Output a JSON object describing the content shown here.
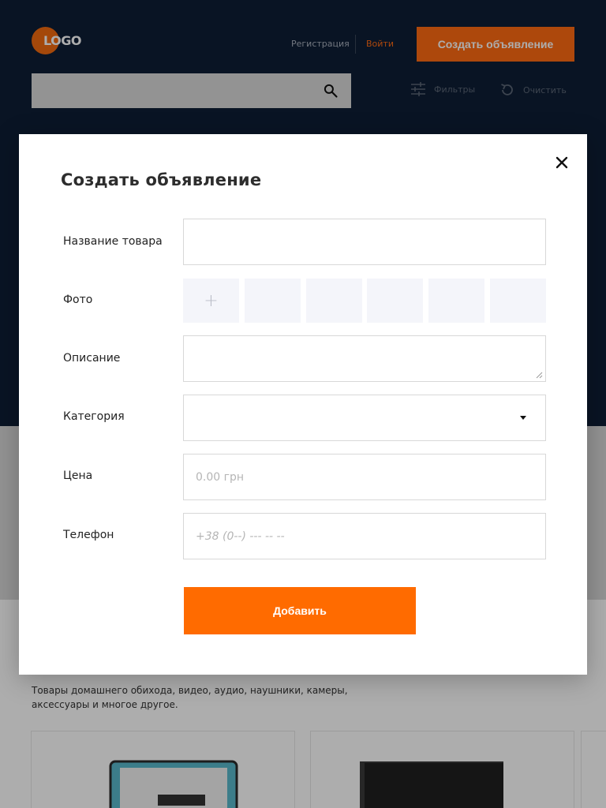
{
  "header": {
    "logo_text": "LOGO",
    "register_label": "Регистрация",
    "login_label": "Войти",
    "create_button_label": "Создать объявление",
    "search": {
      "placeholder": ""
    },
    "filters_label": "Фильтры",
    "clear_label": "Очистить"
  },
  "content": {
    "section_description": "Товары домашнего обихода, видео, аудио, наушники, камеры, аксессуары и многое другое."
  },
  "modal": {
    "title": "Создать объявление",
    "fields": {
      "name": {
        "label": "Название товара",
        "value": ""
      },
      "photo": {
        "label": "Фото",
        "add_glyph": "+"
      },
      "description": {
        "label": "Описание",
        "value": ""
      },
      "category": {
        "label": "Категория",
        "value": ""
      },
      "price": {
        "label": "Цена",
        "placeholder": "0.00 грн"
      },
      "phone": {
        "label": "Телефон",
        "placeholder": "+38 (0--) --- -- --"
      }
    },
    "submit_label": "Добавить"
  },
  "icons": {
    "close": "close-icon",
    "search": "search-icon",
    "filters": "sliders-icon",
    "clear": "refresh-icon",
    "dropdown": "caret-down-icon"
  },
  "colors": {
    "header_bg": "#0e1e35",
    "accent": "#ff6a13",
    "submit": "#ff6b00",
    "photo_slot": "#f4f5fa"
  }
}
